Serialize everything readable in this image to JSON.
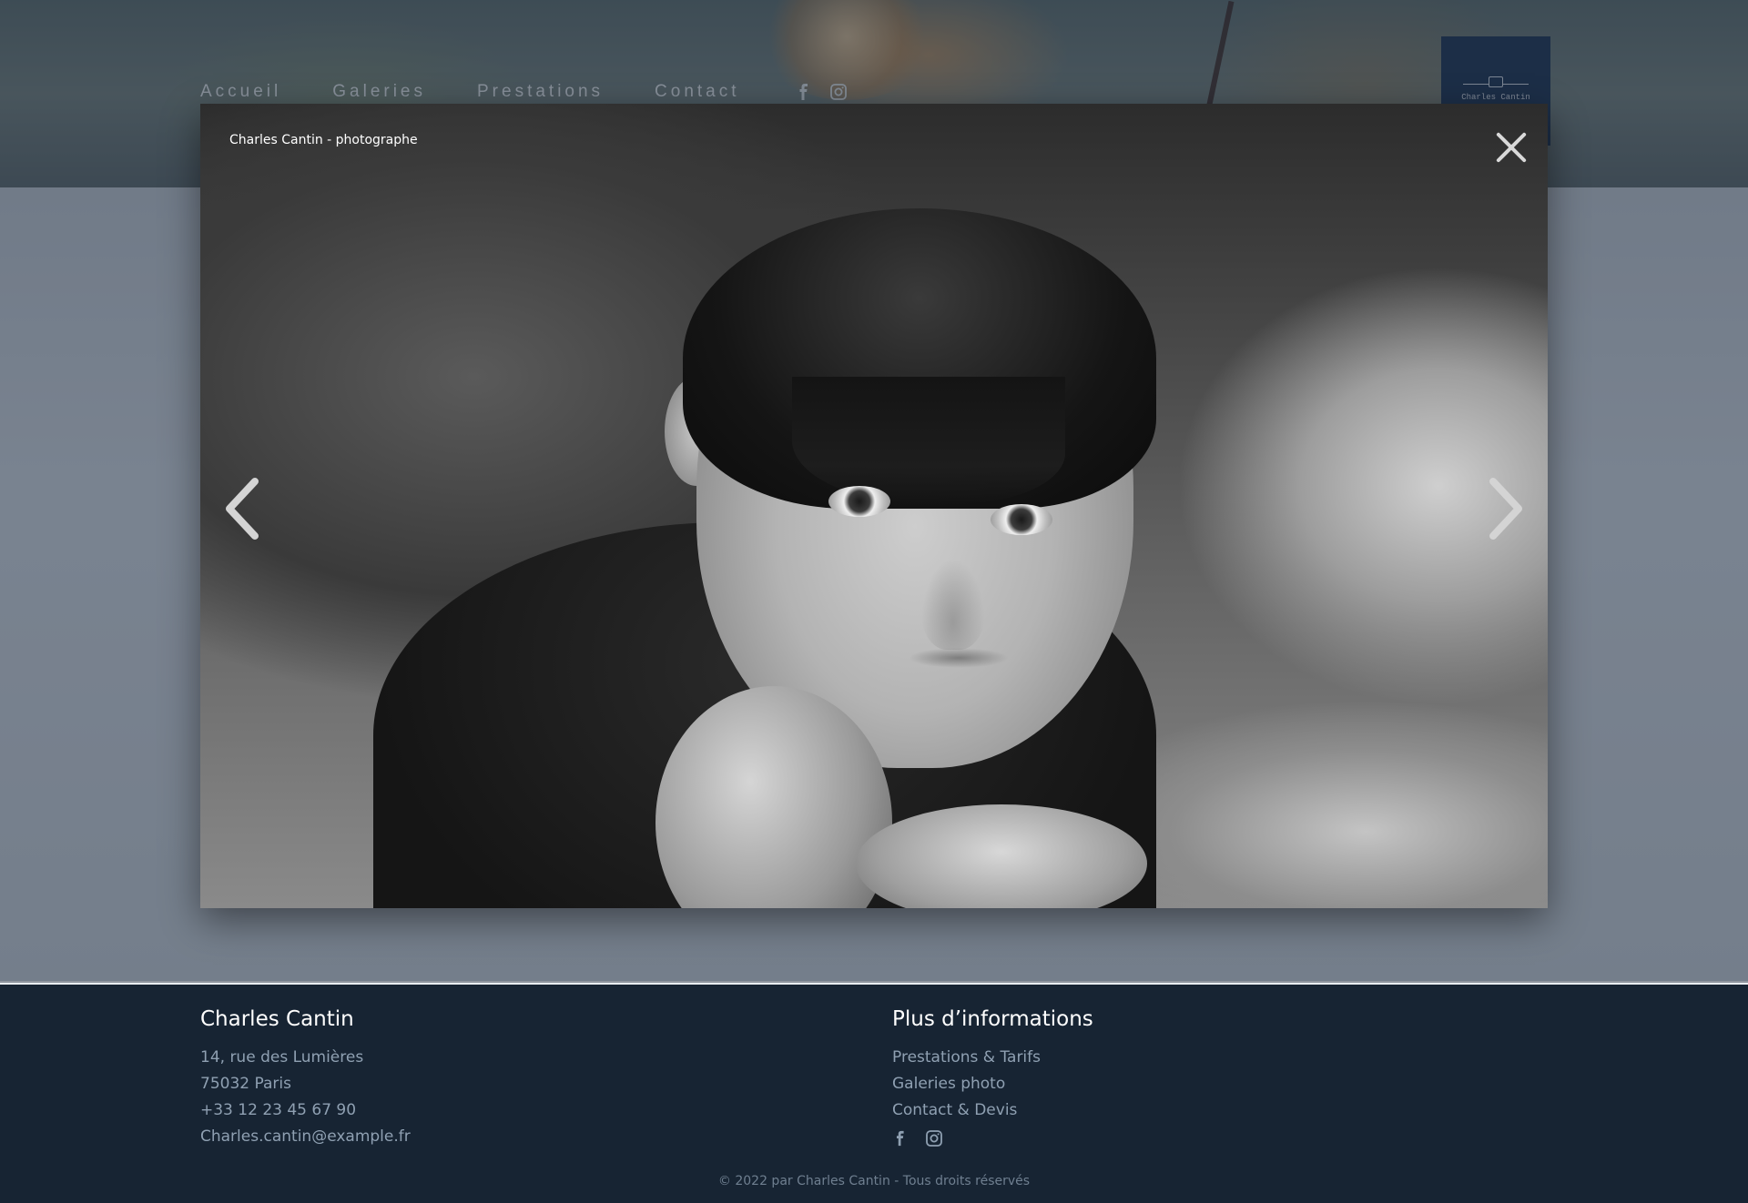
{
  "header": {
    "nav": [
      {
        "label": "Accueil"
      },
      {
        "label": "Galeries"
      },
      {
        "label": "Prestations"
      },
      {
        "label": "Contact"
      }
    ],
    "social": [
      "facebook-icon",
      "instagram-icon"
    ],
    "logo_text": "Charles Cantin"
  },
  "lightbox": {
    "caption": "Charles Cantin - photographe",
    "close_icon": "close-icon",
    "prev_icon": "chevron-left-icon",
    "next_icon": "chevron-right-icon"
  },
  "footer": {
    "left": {
      "title": "Charles Cantin",
      "lines": [
        "14, rue des Lumières",
        "75032 Paris",
        "+33 12 23 45 67 90",
        "Charles.cantin@example.fr"
      ]
    },
    "right": {
      "title": "Plus d’informations",
      "links": [
        "Prestations & Tarifs",
        "Galeries photo",
        "Contact & Devis"
      ]
    },
    "copyright": "© 2022 par Charles Cantin - Tous droits réservés"
  },
  "colors": {
    "footer_bg": "#172433",
    "logo_bg": "#22395a",
    "footer_text": "#8fa0b2"
  }
}
